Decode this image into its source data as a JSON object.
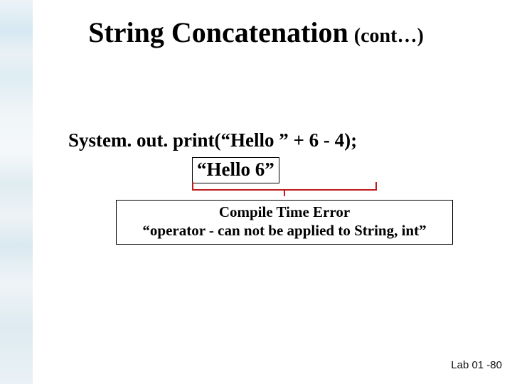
{
  "title": {
    "main": "String Concatenation",
    "sub": "(cont…)"
  },
  "code_line": "System. out. print(“Hello ” + 6 - 4);",
  "intermediate": "“Hello 6”",
  "error": {
    "line1": "Compile Time Error",
    "line2": "“operator - can not be applied to String, int”"
  },
  "footer": "Lab 01 -80"
}
